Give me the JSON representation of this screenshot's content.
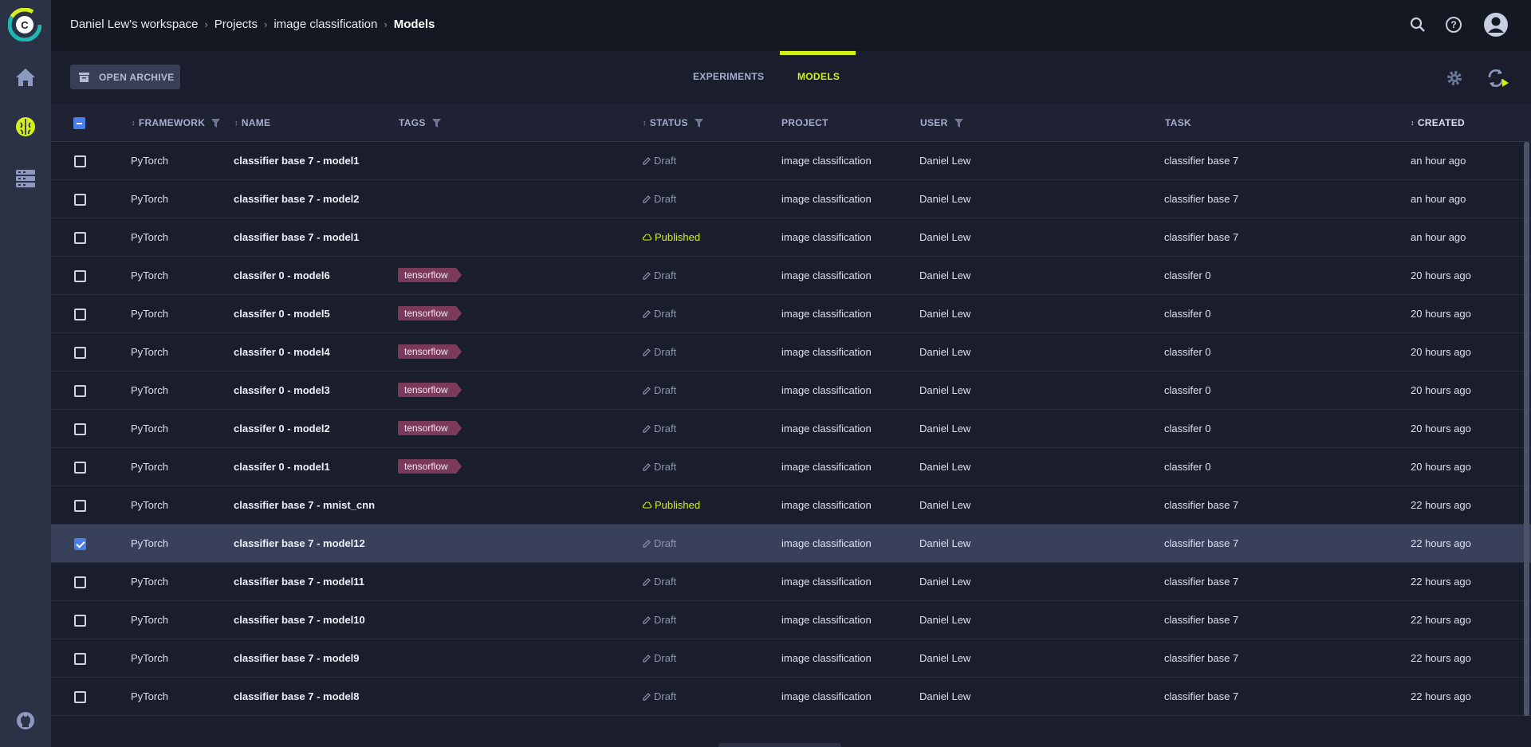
{
  "breadcrumb": {
    "workspace": "Daniel Lew's workspace",
    "projects": "Projects",
    "project": "image classification",
    "current": "Models"
  },
  "toolbar": {
    "archive_label": "OPEN ARCHIVE"
  },
  "tabs": [
    {
      "label": "EXPERIMENTS",
      "active": false
    },
    {
      "label": "MODELS",
      "active": true
    }
  ],
  "table": {
    "columns": {
      "framework": "FRAMEWORK",
      "name": "NAME",
      "tags": "TAGS",
      "status": "STATUS",
      "project": "PROJECT",
      "user": "USER",
      "task": "TASK",
      "created": "CREATED"
    },
    "rows": [
      {
        "framework": "PyTorch",
        "name": "classifier base 7 - model1",
        "tag": "",
        "status": "Draft",
        "project": "image classification",
        "user": "Daniel Lew",
        "task": "classifier base 7",
        "created": "an hour ago",
        "checked": false
      },
      {
        "framework": "PyTorch",
        "name": "classifier base 7 - model2",
        "tag": "",
        "status": "Draft",
        "project": "image classification",
        "user": "Daniel Lew",
        "task": "classifier base 7",
        "created": "an hour ago",
        "checked": false
      },
      {
        "framework": "PyTorch",
        "name": "classifier base 7 - model1",
        "tag": "",
        "status": "Published",
        "project": "image classification",
        "user": "Daniel Lew",
        "task": "classifier base 7",
        "created": "an hour ago",
        "checked": false
      },
      {
        "framework": "PyTorch",
        "name": "classifer 0 - model6",
        "tag": "tensorflow",
        "status": "Draft",
        "project": "image classification",
        "user": "Daniel Lew",
        "task": "classifer 0",
        "created": "20 hours ago",
        "checked": false
      },
      {
        "framework": "PyTorch",
        "name": "classifer 0 - model5",
        "tag": "tensorflow",
        "status": "Draft",
        "project": "image classification",
        "user": "Daniel Lew",
        "task": "classifer 0",
        "created": "20 hours ago",
        "checked": false
      },
      {
        "framework": "PyTorch",
        "name": "classifer 0 - model4",
        "tag": "tensorflow",
        "status": "Draft",
        "project": "image classification",
        "user": "Daniel Lew",
        "task": "classifer 0",
        "created": "20 hours ago",
        "checked": false
      },
      {
        "framework": "PyTorch",
        "name": "classifer 0 - model3",
        "tag": "tensorflow",
        "status": "Draft",
        "project": "image classification",
        "user": "Daniel Lew",
        "task": "classifer 0",
        "created": "20 hours ago",
        "checked": false
      },
      {
        "framework": "PyTorch",
        "name": "classifer 0 - model2",
        "tag": "tensorflow",
        "status": "Draft",
        "project": "image classification",
        "user": "Daniel Lew",
        "task": "classifer 0",
        "created": "20 hours ago",
        "checked": false
      },
      {
        "framework": "PyTorch",
        "name": "classifer 0 - model1",
        "tag": "tensorflow",
        "status": "Draft",
        "project": "image classification",
        "user": "Daniel Lew",
        "task": "classifer 0",
        "created": "20 hours ago",
        "checked": false
      },
      {
        "framework": "PyTorch",
        "name": "classifier base 7 - mnist_cnn",
        "tag": "",
        "status": "Published",
        "project": "image classification",
        "user": "Daniel Lew",
        "task": "classifier base 7",
        "created": "22 hours ago",
        "checked": false
      },
      {
        "framework": "PyTorch",
        "name": "classifier base 7 - model12",
        "tag": "",
        "status": "Draft",
        "project": "image classification",
        "user": "Daniel Lew",
        "task": "classifier base 7",
        "created": "22 hours ago",
        "checked": true
      },
      {
        "framework": "PyTorch",
        "name": "classifier base 7 - model11",
        "tag": "",
        "status": "Draft",
        "project": "image classification",
        "user": "Daniel Lew",
        "task": "classifier base 7",
        "created": "22 hours ago",
        "checked": false
      },
      {
        "framework": "PyTorch",
        "name": "classifier base 7 - model10",
        "tag": "",
        "status": "Draft",
        "project": "image classification",
        "user": "Daniel Lew",
        "task": "classifier base 7",
        "created": "22 hours ago",
        "checked": false
      },
      {
        "framework": "PyTorch",
        "name": "classifier base 7 - model9",
        "tag": "",
        "status": "Draft",
        "project": "image classification",
        "user": "Daniel Lew",
        "task": "classifier base 7",
        "created": "22 hours ago",
        "checked": false
      },
      {
        "framework": "PyTorch",
        "name": "classifier base 7 - model8",
        "tag": "",
        "status": "Draft",
        "project": "image classification",
        "user": "Daniel Lew",
        "task": "classifier base 7",
        "created": "22 hours ago",
        "checked": false
      }
    ]
  },
  "icons": {
    "sidebar": [
      "home-icon",
      "models-brain-icon",
      "datasets-icon",
      "github-icon"
    ],
    "topbar": [
      "search-icon",
      "help-icon",
      "user-avatar-icon"
    ],
    "toolbar": [
      "archive-icon",
      "settings-gear-icon",
      "auto-refresh-icon"
    ]
  },
  "colors": {
    "accent": "#d4f01c",
    "tag": "#7b3a5c",
    "selection": "#38405a",
    "checkbox": "#4a7ee8"
  }
}
